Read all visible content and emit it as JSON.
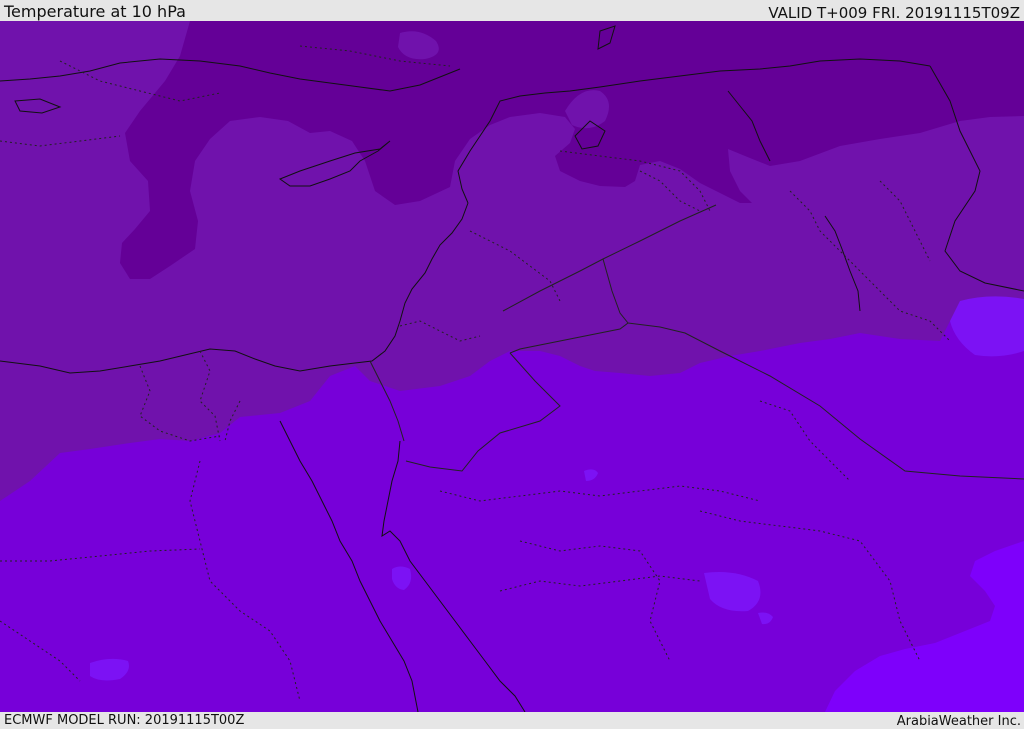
{
  "header": {
    "title": "Temperature at 10 hPa",
    "valid": "VALID T+009 FRI. 20191115T09Z"
  },
  "footer": {
    "model_run": "ECMWF MODEL RUN: 20191115T00Z",
    "credit": "ArabiaWeather Inc."
  },
  "map": {
    "variable": "Temperature",
    "pressure_level_hpa": 10,
    "forecast_hour": 9,
    "fill_colors": {
      "coldest": "#640097",
      "cold": "#7012ac",
      "mild": "#7700d9",
      "warm": "#7c12f4",
      "warmest": "#7e00fb"
    },
    "line_colors": {
      "coastline": "#111111",
      "border": "#222222"
    }
  }
}
